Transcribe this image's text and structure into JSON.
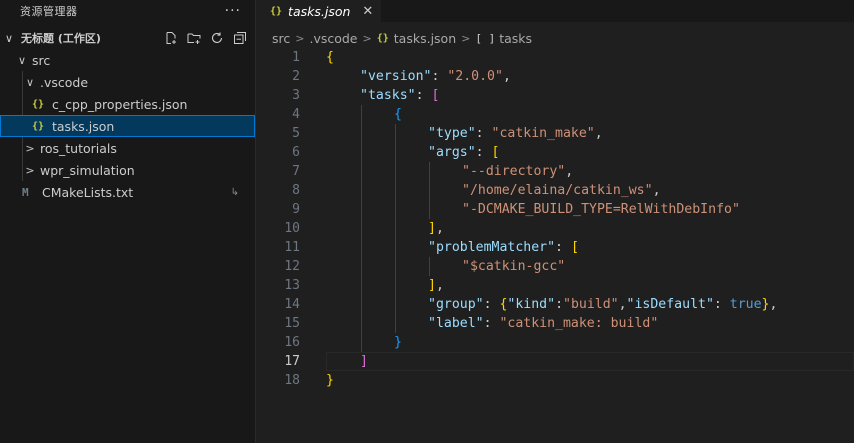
{
  "sidebar": {
    "header_title": "资源管理器",
    "more_label": "···",
    "workspace": {
      "name": "无标题 (工作区)",
      "chevron": "∨"
    },
    "tree": [
      {
        "label": "src",
        "chevron": "∨",
        "icon": ""
      },
      {
        "label": ".vscode",
        "chevron": "∨",
        "icon": ""
      },
      {
        "label": "c_cpp_properties.json",
        "chevron": "",
        "icon": "{}"
      },
      {
        "label": "tasks.json",
        "chevron": "",
        "icon": "{}"
      },
      {
        "label": "ros_tutorials",
        "chevron": ">",
        "icon": ""
      },
      {
        "label": "wpr_simulation",
        "chevron": ">",
        "icon": ""
      },
      {
        "label": "CMakeLists.txt",
        "chevron": "",
        "icon": "M",
        "badge": "↳"
      }
    ]
  },
  "editor": {
    "tab": {
      "icon": "{}",
      "name": "tasks.json",
      "close": "✕"
    },
    "breadcrumb": {
      "items": [
        "src",
        ".vscode",
        "tasks.json",
        "tasks"
      ],
      "file_icon": "{}",
      "symbol_icon": "[ ]"
    },
    "line_numbers": [
      "1",
      "2",
      "3",
      "4",
      "5",
      "6",
      "7",
      "8",
      "9",
      "10",
      "11",
      "12",
      "13",
      "14",
      "15",
      "16",
      "17",
      "18"
    ],
    "active_line": 17,
    "code": {
      "l1_open": "{",
      "l2_key": "\"version\"",
      "l2_colon": ": ",
      "l2_val": "\"2.0.0\"",
      "l2_comma": ",",
      "l3_key": "\"tasks\"",
      "l3_colon": ": ",
      "l3_open": "[",
      "l4_open": "{",
      "l5_key": "\"type\"",
      "l5_colon": ": ",
      "l5_val": "\"catkin_make\"",
      "l5_comma": ",",
      "l6_key": "\"args\"",
      "l6_colon": ": ",
      "l6_open": "[",
      "l7_val": "\"--directory\"",
      "l7_comma": ",",
      "l8_val": "\"/home/elaina/catkin_ws\"",
      "l8_comma": ",",
      "l9_val": "\"-DCMAKE_BUILD_TYPE=RelWithDebInfo\"",
      "l10_close": "]",
      "l10_comma": ",",
      "l11_key": "\"problemMatcher\"",
      "l11_colon": ": ",
      "l11_open": "[",
      "l12_val": "\"$catkin-gcc\"",
      "l13_close": "]",
      "l13_comma": ",",
      "l14_key": "\"group\"",
      "l14_colon": ": ",
      "l14_open": "{",
      "l14_k1": "\"kind\"",
      "l14_c1": ":",
      "l14_v1": "\"build\"",
      "l14_comma1": ",",
      "l14_k2": "\"isDefault\"",
      "l14_c2": ": ",
      "l14_v2": "true",
      "l14_close": "}",
      "l14_comma2": ",",
      "l15_key": "\"label\"",
      "l15_colon": ": ",
      "l15_val": "\"catkin_make: build\"",
      "l16_close": "}",
      "l17_close": "]",
      "l18_close": "}"
    }
  },
  "colors": {
    "json_key": "#9cdcfe",
    "json_string": "#ce9178",
    "bracket_level1": "#ffd700",
    "bracket_level2": "#da70d6",
    "bracket_level3": "#179fff",
    "selection_border": "#0078d4"
  },
  "icons": {
    "new_file": "new-file-icon",
    "new_folder": "new-folder-icon",
    "refresh": "refresh-icon",
    "collapse_all": "collapse-all-icon"
  }
}
